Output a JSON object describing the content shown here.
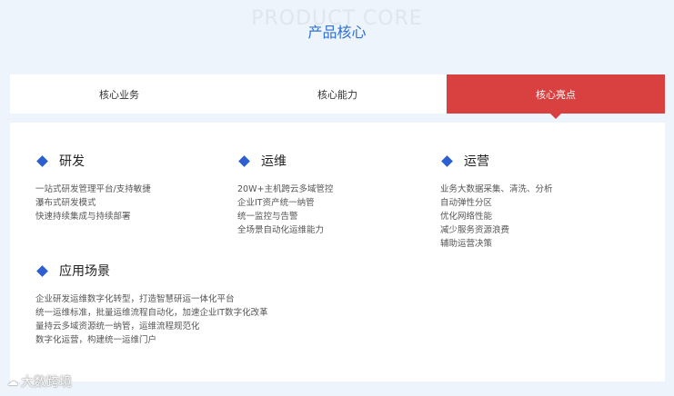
{
  "header": {
    "bg_title": "PRODUCT CORE",
    "title": "产品核心"
  },
  "tabs": [
    {
      "label": "核心业务"
    },
    {
      "label": "核心能力"
    },
    {
      "label": "核心亮点"
    }
  ],
  "sections": {
    "dev": {
      "title": "研发",
      "items": [
        "一站式研发管理平台/支持敏捷",
        "瀑布式研发模式",
        "快速持续集成与持续部署"
      ]
    },
    "ops": {
      "title": "运维",
      "items": [
        "20W+主机跨云多域管控",
        "企业IT资产统一纳管",
        "统一监控与告警",
        "全场景自动化运维能力"
      ]
    },
    "operation": {
      "title": "运营",
      "items": [
        "业务大数据采集、清洗、分析",
        "自动弹性分区",
        "优化网络性能",
        "减少服务资源浪费",
        "辅助运营决策"
      ]
    },
    "scenario": {
      "title": "应用场景",
      "items": [
        "企业研发运维数字化转型，打造智慧研运一体化平台",
        "统一运维标准，批量运维流程自动化，加速企业IT数字化改革",
        "量持云多域资源统一纳管，运维流程规范化",
        "数字化运营，构建统一运维门户"
      ]
    }
  },
  "watermark": {
    "icon": "cloud-icon",
    "text": "大数跨境"
  }
}
